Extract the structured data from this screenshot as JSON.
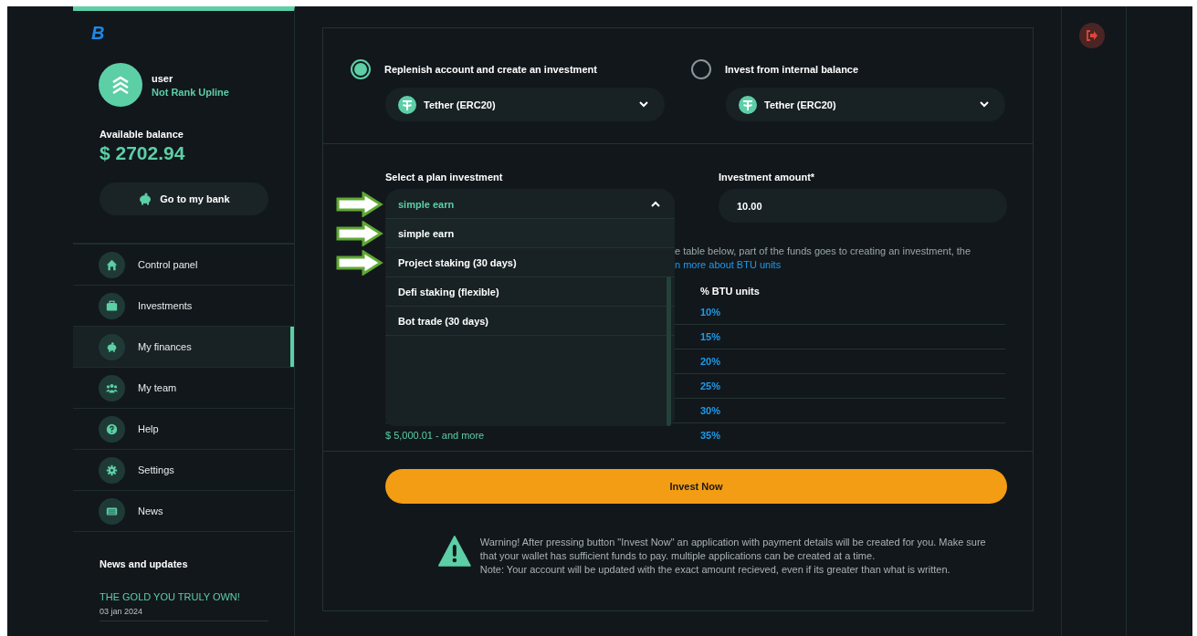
{
  "logo": "B",
  "user": {
    "name": "user",
    "rank": "Not Rank Upline"
  },
  "balance": {
    "label": "Available balance",
    "value": "$ 2702.94"
  },
  "bank_button": "Go to my bank",
  "nav": [
    {
      "label": "Control panel",
      "kind": "home",
      "selected": false
    },
    {
      "label": "Investments",
      "kind": "briefcase",
      "selected": false
    },
    {
      "label": "My finances",
      "kind": "piggy",
      "selected": true
    },
    {
      "label": "My team",
      "kind": "team",
      "selected": false
    },
    {
      "label": "Help",
      "kind": "help",
      "selected": false
    },
    {
      "label": "Settings",
      "kind": "gear",
      "selected": false
    },
    {
      "label": "News",
      "kind": "news",
      "selected": false
    }
  ],
  "news": {
    "heading": "News and updates",
    "items": [
      {
        "title": "THE GOLD YOU TRULY OWN!",
        "date": "03 jan 2024"
      }
    ]
  },
  "funding": [
    {
      "label": "Replenish account and create an investment",
      "selected": true,
      "currency": "Tether (ERC20)"
    },
    {
      "label": "Invest from internal balance",
      "selected": false,
      "currency": "Tether (ERC20)"
    }
  ],
  "plan": {
    "label": "Select a plan investment",
    "value": "simple earn",
    "expanded": true,
    "options": [
      {
        "label": "simple earn",
        "selected": true
      },
      {
        "label": "Project staking (30 days)",
        "selected": false
      },
      {
        "label": "Defi staking (flexible)",
        "selected": false
      },
      {
        "label": "Bot trade (30 days)",
        "selected": false
      }
    ]
  },
  "amount": {
    "label": "Investment amount*",
    "value": "10.00"
  },
  "info": {
    "text": "e table below, part of the funds goes to creating an investment, the",
    "link": "n more about BTU units"
  },
  "table": {
    "columns": [
      "% BTU units"
    ],
    "rows": [
      {
        "btu": "10%"
      },
      {
        "btu": "15%"
      },
      {
        "btu": "20%"
      },
      {
        "btu": "25%"
      },
      {
        "btu": "30%"
      },
      {
        "range": "$ 5,000.01 - and more",
        "btu": "35%"
      }
    ]
  },
  "invest_button": "Invest Now",
  "warning": {
    "lines": [
      "Warning! After pressing button \"Invest Now\" an application with payment details will be created for you. Make sure that your wallet has sufficient funds to pay. multiple applications can be created at a time.",
      "Note: Your account will be updated with the exact amount recieved, even if its greater than what is written."
    ]
  }
}
